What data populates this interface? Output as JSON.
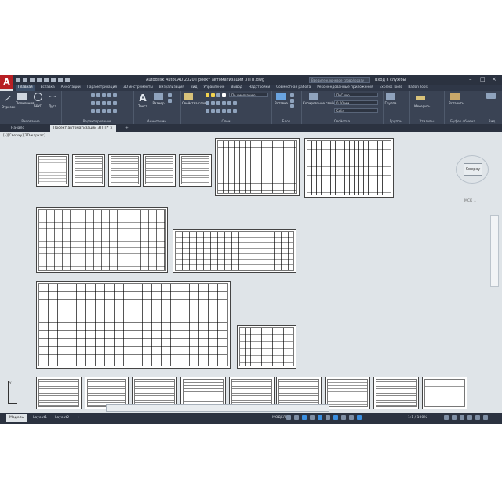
{
  "app": {
    "logo_letter": "A",
    "title": "Autodesk AutoCAD 2020   Проект автоматизации ЗТПТ.dwg",
    "search_placeholder": "Введите ключевое слово/фразу",
    "sign_in": "Вход в службы",
    "window_controls": [
      "–",
      "□",
      "×"
    ]
  },
  "menu": {
    "tabs": [
      "Главная",
      "Вставка",
      "Аннотации",
      "Параметризация",
      "3D инструменты",
      "Визуализация",
      "Вид",
      "Управление",
      "Вывод",
      "Надстройки",
      "Совместная работа",
      "Рекомендованные приложения",
      "Express Tools",
      "Badon Tools"
    ],
    "active_index": 0
  },
  "ribbon": {
    "draw": {
      "label": "Рисование",
      "tools": [
        "Отрезок",
        "Полилиния",
        "Круг",
        "Дуга"
      ]
    },
    "modify": {
      "label": "Редактирование"
    },
    "annotation": {
      "label": "Аннотации",
      "tools": [
        "Текст",
        "Размер"
      ]
    },
    "layers": {
      "label": "Слои",
      "tool": "Свойства слоя",
      "current_layer": "По умолчанию"
    },
    "block": {
      "label": "Блок",
      "tool": "Вставка"
    },
    "properties": {
      "label": "Свойства",
      "tool": "Копирование свойств",
      "bylayer": "ПоСлою",
      "lineweight": "0.00 мм",
      "linetype": "Solid"
    },
    "groups": {
      "label": "Группы",
      "tool": "Группа"
    },
    "utilities": {
      "label": "Утилиты",
      "tool": "Измерить"
    },
    "clipboard": {
      "label": "Буфер обмена",
      "tool": "Вставить"
    },
    "view": {
      "label": "Вид"
    }
  },
  "file_tabs": [
    {
      "label": "Начало",
      "active": false
    },
    {
      "label": "Проект автоматизации ЗТПТ* ×",
      "active": true
    }
  ],
  "viewport": {
    "label": "[–][Сверху][2D-каркас]",
    "viewcube_face": "Сверху",
    "wcs": "МСК ⌄"
  },
  "ucs": {
    "y_label": "Y"
  },
  "command_line": {
    "placeholder": ""
  },
  "status": {
    "layout_tabs": [
      "Модель",
      "Layout1",
      "Layout2",
      "+"
    ],
    "active_layout": 0,
    "model_label": "МОДЕЛЬ",
    "scale": "1:1 / 100%"
  },
  "colors": {
    "title_bg": "#2b3240",
    "ribbon_bg": "#3a4354",
    "canvas_bg": "#dfe4e8",
    "logo_red": "#b71f24",
    "accent_blue": "#3b8fe0"
  }
}
